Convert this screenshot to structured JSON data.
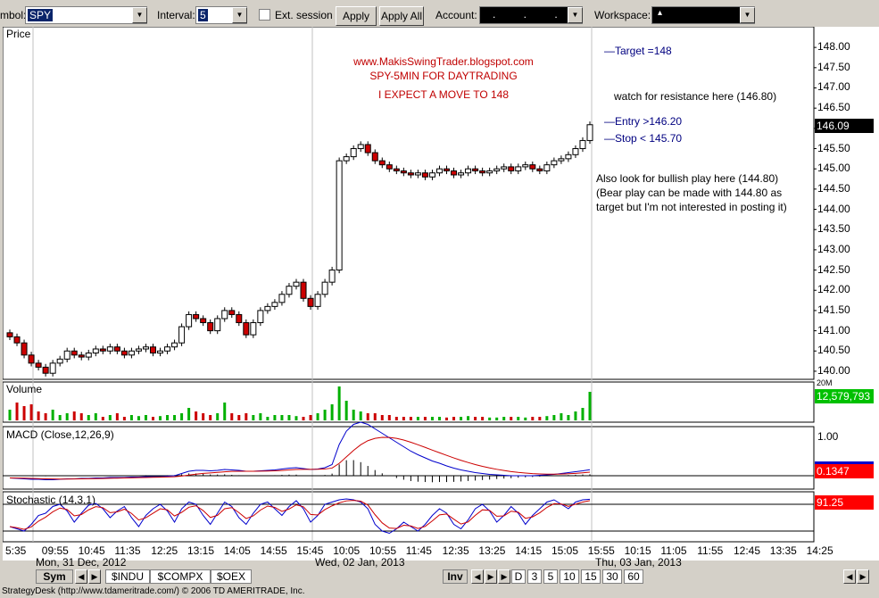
{
  "toolbar": {
    "symbol_label": "mbol:",
    "symbol_value": "SPY",
    "interval_label": "Interval:",
    "interval_value": "5",
    "ext_session_label": "Ext. session",
    "apply_label": "Apply",
    "apply_all_label": "Apply All",
    "account_label": "Account:",
    "account_value": ". . . .",
    "workspace_label": "Workspace:",
    "workspace_value": "▴"
  },
  "price_panel": {
    "label": "Price",
    "watermark": "www.MakisSwingTrader.blogspot.com",
    "subtitle": "SPY-5MIN FOR DAYTRADING",
    "expectation": "I EXPECT A MOVE TO 148",
    "target": "Target =148",
    "resistance": "watch for resistance here (146.80)",
    "entry": "Entry >146.20",
    "stop": "Stop < 145.70",
    "bullish": "Also look for bullish play here (144.80)",
    "bear_1": "(Bear play can be made with 144.80 as",
    "bear_2": "target but I'm not interested in posting it)",
    "last_price": "146.09",
    "ticks": [
      "148.00",
      "147.50",
      "147.00",
      "146.50",
      "146.00",
      "145.50",
      "145.00",
      "144.50",
      "144.00",
      "143.50",
      "143.00",
      "142.50",
      "142.00",
      "141.50",
      "141.00",
      "140.50",
      "140.00"
    ]
  },
  "volume_panel": {
    "label": "Volume",
    "value": "12,579,793",
    "scale": "20M"
  },
  "macd_panel": {
    "label": "MACD (Close,12,26,9)",
    "tick": "1.00",
    "value": "0.1347"
  },
  "stoch_panel": {
    "label": "Stochastic (14,3,1)",
    "value": "91.25"
  },
  "x_axis": {
    "times": [
      "5:35",
      "09:55",
      "10:45",
      "11:35",
      "12:25",
      "13:15",
      "14:05",
      "14:55",
      "15:45",
      "10:05",
      "10:55",
      "11:45",
      "12:35",
      "13:25",
      "14:15",
      "15:05",
      "15:55",
      "10:15",
      "11:05",
      "11:55",
      "12:45",
      "13:35",
      "14:25"
    ],
    "dates": [
      "Mon, 31 Dec, 2012",
      "Wed, 02 Jan, 2013",
      "Thu, 03 Jan, 2013"
    ]
  },
  "bottom": {
    "sym_tab": "Sym",
    "tabs": [
      "$INDU",
      "$COMPX",
      "$OEX"
    ],
    "inv": "Inv",
    "periods": [
      "D",
      "3",
      "5",
      "10",
      "15",
      "30",
      "60"
    ]
  },
  "colors": {
    "up": "#000000",
    "down": "#cc0000",
    "volume": "#00b000",
    "macd": "#0000cc",
    "signal": "#cc0000",
    "value_green": "#00c000",
    "value_red": "#ff0000"
  },
  "status": "StrategyDesk (http://www.tdameritrade.com/) © 2006 TD AMERITRADE, Inc.",
  "chart_data": {
    "type": "candlestick",
    "price_ylim": [
      139.8,
      148.4
    ],
    "close": [
      140.85,
      140.7,
      140.4,
      140.2,
      140.1,
      139.95,
      140.2,
      140.3,
      140.5,
      140.4,
      140.35,
      140.45,
      140.55,
      140.5,
      140.6,
      140.5,
      140.4,
      140.5,
      140.55,
      140.6,
      140.45,
      140.5,
      140.6,
      140.7,
      141.1,
      141.4,
      141.3,
      141.2,
      141.0,
      141.3,
      141.5,
      141.4,
      141.2,
      140.9,
      141.2,
      141.5,
      141.6,
      141.7,
      141.9,
      142.1,
      142.2,
      141.8,
      141.6,
      141.9,
      142.2,
      142.5,
      145.2,
      145.3,
      145.5,
      145.6,
      145.4,
      145.2,
      145.1,
      145.0,
      144.95,
      144.9,
      144.85,
      144.9,
      144.8,
      144.9,
      145.0,
      144.95,
      144.85,
      144.9,
      145.0,
      144.95,
      144.9,
      144.95,
      145.0,
      145.05,
      144.95,
      145.05,
      145.1,
      145.0,
      144.95,
      145.1,
      145.2,
      145.25,
      145.35,
      145.5,
      145.7,
      146.09
    ],
    "volume_relative": [
      0.3,
      0.5,
      0.4,
      0.45,
      0.25,
      0.2,
      0.3,
      0.15,
      0.2,
      0.25,
      0.2,
      0.15,
      0.2,
      0.1,
      0.15,
      0.2,
      0.1,
      0.15,
      0.12,
      0.15,
      0.1,
      0.12,
      0.15,
      0.15,
      0.2,
      0.35,
      0.25,
      0.2,
      0.15,
      0.2,
      0.5,
      0.2,
      0.15,
      0.2,
      0.15,
      0.2,
      0.1,
      0.15,
      0.15,
      0.15,
      0.12,
      0.1,
      0.15,
      0.2,
      0.3,
      0.45,
      0.95,
      0.55,
      0.3,
      0.25,
      0.2,
      0.2,
      0.15,
      0.15,
      0.1,
      0.1,
      0.1,
      0.1,
      0.1,
      0.1,
      0.1,
      0.08,
      0.1,
      0.1,
      0.12,
      0.1,
      0.1,
      0.08,
      0.08,
      0.1,
      0.1,
      0.1,
      0.08,
      0.1,
      0.1,
      0.12,
      0.15,
      0.2,
      0.15,
      0.25,
      0.35,
      0.8
    ],
    "macd": [
      -0.05,
      -0.06,
      -0.07,
      -0.08,
      -0.08,
      -0.09,
      -0.09,
      -0.08,
      -0.07,
      -0.07,
      -0.06,
      -0.06,
      -0.05,
      -0.05,
      -0.04,
      -0.04,
      -0.04,
      -0.03,
      -0.03,
      -0.02,
      -0.02,
      -0.02,
      -0.01,
      0.0,
      0.05,
      0.1,
      0.12,
      0.12,
      0.11,
      0.12,
      0.14,
      0.13,
      0.12,
      0.1,
      0.1,
      0.11,
      0.12,
      0.13,
      0.15,
      0.17,
      0.18,
      0.16,
      0.14,
      0.15,
      0.18,
      0.25,
      0.7,
      1.0,
      1.15,
      1.2,
      1.15,
      1.05,
      0.95,
      0.85,
      0.75,
      0.65,
      0.55,
      0.47,
      0.4,
      0.33,
      0.28,
      0.22,
      0.17,
      0.13,
      0.1,
      0.07,
      0.05,
      0.03,
      0.02,
      0.01,
      0.0,
      0.0,
      0.0,
      0.0,
      0.01,
      0.02,
      0.03,
      0.05,
      0.07,
      0.09,
      0.11,
      0.1347
    ],
    "stochastic": [
      30,
      25,
      20,
      35,
      55,
      60,
      75,
      80,
      65,
      40,
      60,
      78,
      82,
      70,
      50,
      65,
      75,
      50,
      30,
      55,
      70,
      80,
      65,
      40,
      70,
      85,
      80,
      55,
      35,
      60,
      85,
      75,
      50,
      35,
      60,
      80,
      85,
      70,
      55,
      75,
      88,
      70,
      40,
      55,
      80,
      85,
      90,
      92,
      90,
      85,
      70,
      35,
      20,
      15,
      25,
      40,
      30,
      20,
      35,
      55,
      70,
      60,
      35,
      25,
      45,
      70,
      80,
      65,
      40,
      55,
      75,
      60,
      35,
      55,
      70,
      85,
      90,
      80,
      70,
      85,
      90,
      91.25
    ]
  }
}
